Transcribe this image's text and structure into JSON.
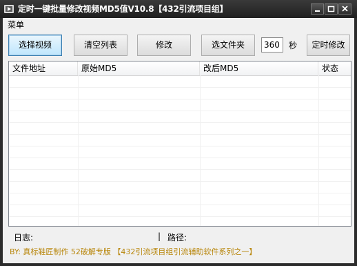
{
  "window": {
    "title": "定时一键批量修改视频MD5值V10.8【432引流项目组】",
    "controls": [
      "minimize",
      "maximize",
      "close"
    ]
  },
  "menu": {
    "label": "菜单"
  },
  "toolbar": {
    "select_video": "选择视频",
    "clear_list": "清空列表",
    "modify": "修改",
    "select_folder": "选文件夹",
    "seconds_value": "360",
    "seconds_unit": "秒",
    "timed_modify": "定时修改"
  },
  "table": {
    "columns": [
      "文件地址",
      "原始MD5",
      "改后MD5",
      "状态"
    ],
    "rows": []
  },
  "status": {
    "log_label": "日志:",
    "separator": "|",
    "path_label": "路径:"
  },
  "footer": {
    "text": "BY: 真标鞋匠制作 52破解专版 【432引流项目组引流辅助软件系列之一】"
  },
  "colors": {
    "titlebar": "#1f1f1f",
    "footer_text": "#b8860b",
    "focus_border": "#3c7fb1"
  }
}
